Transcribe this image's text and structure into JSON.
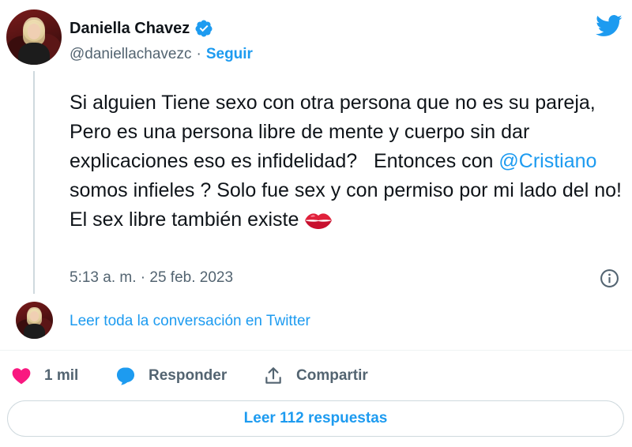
{
  "author": {
    "name": "Daniella Chavez",
    "handle": "@daniellachavezc",
    "separator": "·",
    "follow_label": "Seguir"
  },
  "tweet": {
    "text_part1": "Si alguien Tiene sexo con otra persona que no es su pareja, Pero es una persona libre de mente y cuerpo sin dar explicaciones eso es infidelidad?   Entonces con ",
    "mention": "@Cristiano",
    "text_part2": " somos infieles ? Solo fue sex y con permiso por mi lado del no!   El sex libre también existe",
    "emoji": "kiss-mark-icon",
    "timestamp": "5:13 a. m. · 25 feb. 2023"
  },
  "conversation": {
    "link_label": "Leer toda la conversación en Twitter"
  },
  "actions": {
    "like_count": "1 mil",
    "reply_label": "Responder",
    "share_label": "Compartir"
  },
  "replies_button": {
    "label": "Leer 112 respuestas"
  },
  "colors": {
    "accent": "#1d9bf0",
    "like": "#f91880",
    "muted": "#536471"
  },
  "icons": [
    "verified-badge-icon",
    "twitter-bird-icon",
    "info-icon",
    "heart-icon",
    "reply-bubble-icon",
    "share-icon",
    "kiss-mark-icon"
  ]
}
